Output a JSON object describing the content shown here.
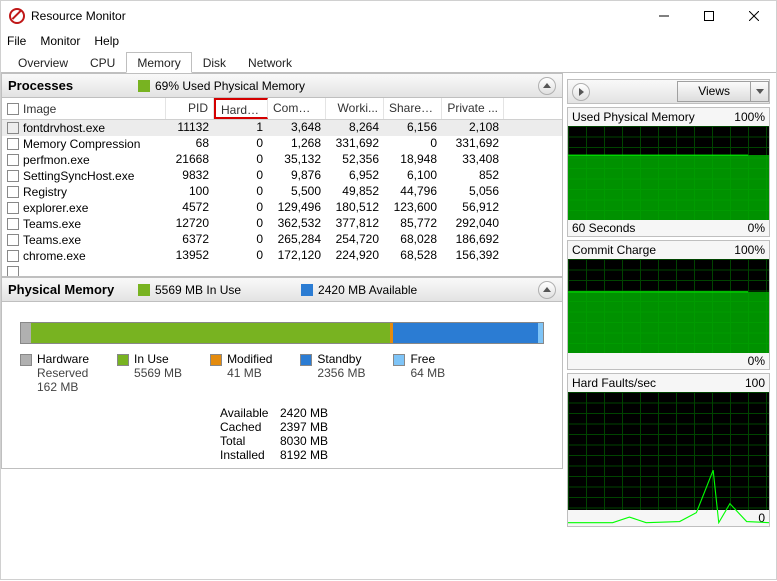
{
  "window": {
    "title": "Resource Monitor"
  },
  "menu": {
    "file": "File",
    "monitor": "Monitor",
    "help": "Help"
  },
  "tabs": {
    "overview": "Overview",
    "cpu": "CPU",
    "memory": "Memory",
    "disk": "Disk",
    "network": "Network"
  },
  "processes": {
    "title": "Processes",
    "summary": "69% Used Physical Memory",
    "columns": {
      "image": "Image",
      "pid": "PID",
      "hfaults": "Hard F...",
      "commit": "Commi...",
      "working": "Worki...",
      "shareable": "Sharea...",
      "private": "Private ..."
    },
    "rows": [
      {
        "image": "fontdrvhost.exe",
        "pid": "11132",
        "hf": "1",
        "commit": "3,648",
        "work": "8,264",
        "share": "6,156",
        "priv": "2,108"
      },
      {
        "image": "Memory Compression",
        "pid": "68",
        "hf": "0",
        "commit": "1,268",
        "work": "331,692",
        "share": "0",
        "priv": "331,692"
      },
      {
        "image": "perfmon.exe",
        "pid": "21668",
        "hf": "0",
        "commit": "35,132",
        "work": "52,356",
        "share": "18,948",
        "priv": "33,408"
      },
      {
        "image": "SettingSyncHost.exe",
        "pid": "9832",
        "hf": "0",
        "commit": "9,876",
        "work": "6,952",
        "share": "6,100",
        "priv": "852"
      },
      {
        "image": "Registry",
        "pid": "100",
        "hf": "0",
        "commit": "5,500",
        "work": "49,852",
        "share": "44,796",
        "priv": "5,056"
      },
      {
        "image": "explorer.exe",
        "pid": "4572",
        "hf": "0",
        "commit": "129,496",
        "work": "180,512",
        "share": "123,600",
        "priv": "56,912"
      },
      {
        "image": "Teams.exe",
        "pid": "12720",
        "hf": "0",
        "commit": "362,532",
        "work": "377,812",
        "share": "85,772",
        "priv": "292,040"
      },
      {
        "image": "Teams.exe",
        "pid": "6372",
        "hf": "0",
        "commit": "265,284",
        "work": "254,720",
        "share": "68,028",
        "priv": "186,692"
      },
      {
        "image": "chrome.exe",
        "pid": "13952",
        "hf": "0",
        "commit": "172,120",
        "work": "224,920",
        "share": "68,528",
        "priv": "156,392"
      },
      {
        "image": "",
        "pid": "",
        "hf": "",
        "commit": "",
        "work": "",
        "share": "",
        "priv": ""
      }
    ]
  },
  "physmem": {
    "title": "Physical Memory",
    "in_use_text": "5569 MB In Use",
    "avail_text": "2420 MB Available",
    "legend": {
      "hw": {
        "label": "Hardware",
        "label2": "Reserved",
        "value": "162 MB"
      },
      "inuse": {
        "label": "In Use",
        "value": "5569 MB"
      },
      "mod": {
        "label": "Modified",
        "value": "41 MB"
      },
      "standby": {
        "label": "Standby",
        "value": "2356 MB"
      },
      "free": {
        "label": "Free",
        "value": "64 MB"
      }
    },
    "stats": {
      "available": {
        "label": "Available",
        "val": "2420 MB"
      },
      "cached": {
        "label": "Cached",
        "val": "2397 MB"
      },
      "total": {
        "label": "Total",
        "val": "8030 MB"
      },
      "installed": {
        "label": "Installed",
        "val": "8192 MB"
      }
    },
    "colors": {
      "hw": "#b0b0b0",
      "inuse": "#78b321",
      "mod": "#e48b0d",
      "standby": "#2b7cd3",
      "free": "#7ec4f7"
    },
    "widths": {
      "hw": "2%",
      "inuse": "69%",
      "mod": "0.6%",
      "standby": "28%",
      "free": "0.9%"
    }
  },
  "right": {
    "views": "Views",
    "charts": [
      {
        "title": "Used Physical Memory",
        "topval": "100%",
        "bl": "60 Seconds",
        "br": "0%",
        "fill_pct": 69
      },
      {
        "title": "Commit Charge",
        "topval": "100%",
        "bl": "",
        "br": "0%",
        "fill_pct": 65
      },
      {
        "title": "Hard Faults/sec",
        "topval": "100",
        "bl": "",
        "br": "0",
        "fill_pct": 0
      }
    ]
  }
}
